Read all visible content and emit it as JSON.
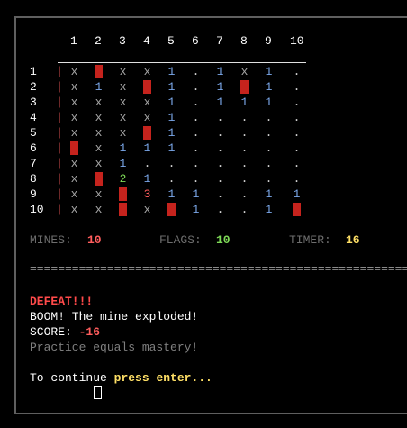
{
  "colors": {
    "red": "#ff5d5d",
    "green": "#7ed957",
    "yellow": "#ffe066",
    "blue": "#7aa6e8",
    "gray": "#6d6d6d",
    "flag": "#c5231d"
  },
  "board": {
    "columns": [
      "1",
      "2",
      "3",
      "4",
      "5",
      "6",
      "7",
      "8",
      "9",
      "10"
    ],
    "row_labels": [
      "1",
      "2",
      "3",
      "4",
      "5",
      "6",
      "7",
      "8",
      "9",
      "10"
    ],
    "row_separator": "|",
    "rows": [
      [
        "x",
        "F",
        "x",
        "x",
        "1",
        ".",
        "1",
        "x",
        "1",
        "."
      ],
      [
        "x",
        "1",
        "x",
        "F",
        "1",
        ".",
        "1",
        "F",
        "1",
        "."
      ],
      [
        "x",
        "x",
        "x",
        "x",
        "1",
        ".",
        "1",
        "1",
        "1",
        "."
      ],
      [
        "x",
        "x",
        "x",
        "x",
        "1",
        ".",
        ".",
        ".",
        ".",
        "."
      ],
      [
        "x",
        "x",
        "x",
        "F",
        "1",
        ".",
        ".",
        ".",
        ".",
        "."
      ],
      [
        "F",
        "x",
        "1",
        "1",
        "1",
        ".",
        ".",
        ".",
        ".",
        "."
      ],
      [
        "x",
        "x",
        "1",
        ".",
        ".",
        ".",
        ".",
        ".",
        ".",
        "."
      ],
      [
        "x",
        "F",
        "2",
        "1",
        ".",
        ".",
        ".",
        ".",
        ".",
        "."
      ],
      [
        "x",
        "x",
        "F",
        "3",
        "1",
        "1",
        ".",
        ".",
        "1",
        "1"
      ],
      [
        "x",
        "x",
        "F",
        "x",
        "F",
        "1",
        ".",
        ".",
        "1",
        "F"
      ]
    ]
  },
  "stats": {
    "mines_label": "MINES:",
    "mines_value": "10",
    "flags_label": "FLAGS:",
    "flags_value": "10",
    "timer_label": "TIMER:",
    "timer_value": "16"
  },
  "separator": "=====================================================================",
  "result": {
    "title": "DEFEAT!!!",
    "message": "BOOM! The mine exploded!",
    "score_label": "SCORE:",
    "score_value": "-16",
    "tip": "Practice equals mastery!",
    "continue_prefix": "To continue",
    "continue_action": "press enter..."
  }
}
